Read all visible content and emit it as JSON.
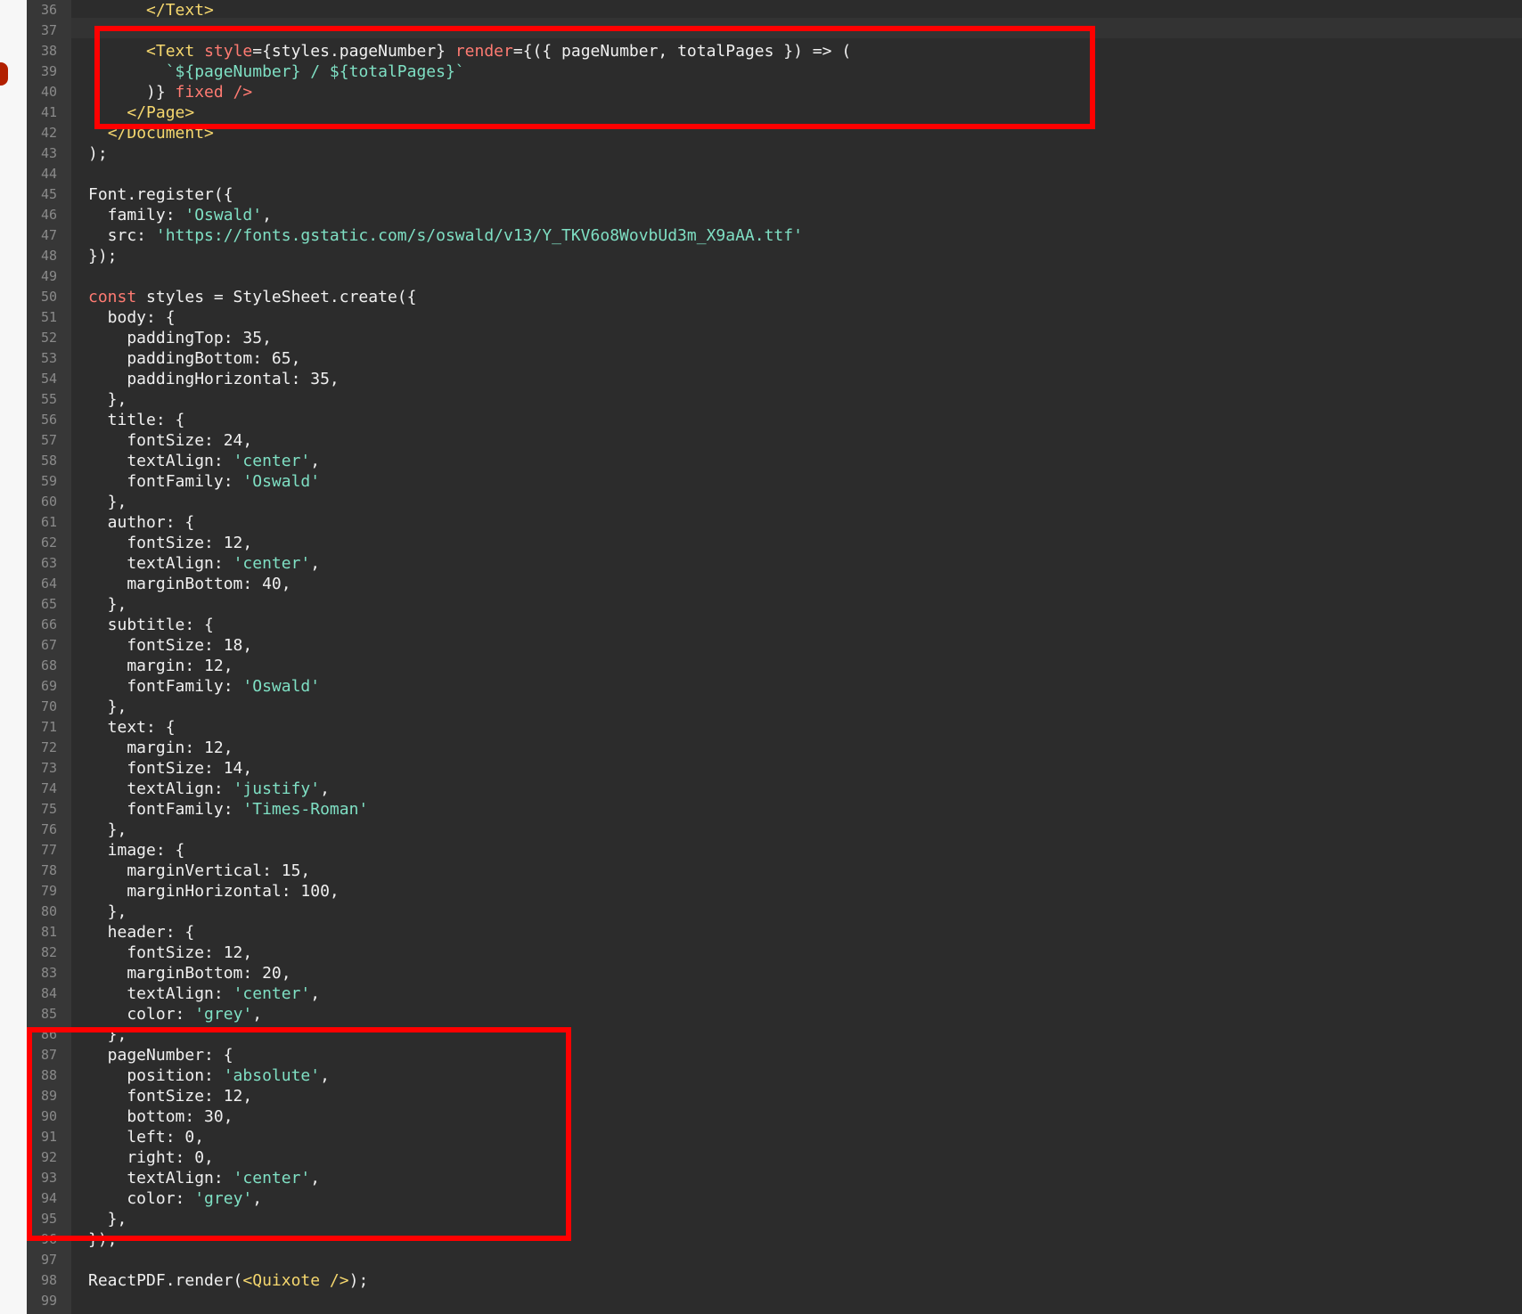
{
  "editor": {
    "highlight_color": "#ff0000",
    "first_line_number": 36,
    "lines": [
      {
        "n": "36",
        "tokens": [
          {
            "t": "      ",
            "c": "plain"
          },
          {
            "t": "</Text>",
            "c": "tag"
          }
        ]
      },
      {
        "n": "37",
        "tokens": []
      },
      {
        "n": "38",
        "tokens": [
          {
            "t": "      ",
            "c": "plain"
          },
          {
            "t": "<Text ",
            "c": "tag"
          },
          {
            "t": "style",
            "c": "attr"
          },
          {
            "t": "={styles.pageNumber} ",
            "c": "plain"
          },
          {
            "t": "render",
            "c": "attr"
          },
          {
            "t": "={({ pageNumber, totalPages }) => (",
            "c": "plain"
          }
        ]
      },
      {
        "n": "39",
        "tokens": [
          {
            "t": "        ",
            "c": "plain"
          },
          {
            "t": "`${pageNumber} / ${totalPages}`",
            "c": "str"
          }
        ]
      },
      {
        "n": "40",
        "tokens": [
          {
            "t": "      )} ",
            "c": "plain"
          },
          {
            "t": "fixed",
            "c": "attr"
          },
          {
            "t": " />",
            "c": "attr"
          }
        ]
      },
      {
        "n": "41",
        "tokens": [
          {
            "t": "    ",
            "c": "plain"
          },
          {
            "t": "</Page>",
            "c": "tag"
          }
        ]
      },
      {
        "n": "42",
        "tokens": [
          {
            "t": "  ",
            "c": "plain"
          },
          {
            "t": "</Document>",
            "c": "tag"
          }
        ]
      },
      {
        "n": "43",
        "tokens": [
          {
            "t": ");",
            "c": "plain"
          }
        ]
      },
      {
        "n": "44",
        "tokens": []
      },
      {
        "n": "45",
        "tokens": [
          {
            "t": "Font.register({",
            "c": "plain"
          }
        ]
      },
      {
        "n": "46",
        "tokens": [
          {
            "t": "  family: ",
            "c": "plain"
          },
          {
            "t": "'Oswald'",
            "c": "str"
          },
          {
            "t": ",",
            "c": "plain"
          }
        ]
      },
      {
        "n": "47",
        "tokens": [
          {
            "t": "  src: ",
            "c": "plain"
          },
          {
            "t": "'https://fonts.gstatic.com/s/oswald/v13/Y_TKV6o8WovbUd3m_X9aAA.ttf'",
            "c": "str"
          }
        ]
      },
      {
        "n": "48",
        "tokens": [
          {
            "t": "});",
            "c": "plain"
          }
        ]
      },
      {
        "n": "49",
        "tokens": []
      },
      {
        "n": "50",
        "tokens": [
          {
            "t": "const",
            "c": "kw"
          },
          {
            "t": " styles = StyleSheet.create({",
            "c": "plain"
          }
        ]
      },
      {
        "n": "51",
        "tokens": [
          {
            "t": "  body: {",
            "c": "plain"
          }
        ]
      },
      {
        "n": "52",
        "tokens": [
          {
            "t": "    paddingTop: 35,",
            "c": "plain"
          }
        ]
      },
      {
        "n": "53",
        "tokens": [
          {
            "t": "    paddingBottom: 65,",
            "c": "plain"
          }
        ]
      },
      {
        "n": "54",
        "tokens": [
          {
            "t": "    paddingHorizontal: 35,",
            "c": "plain"
          }
        ]
      },
      {
        "n": "55",
        "tokens": [
          {
            "t": "  },",
            "c": "plain"
          }
        ]
      },
      {
        "n": "56",
        "tokens": [
          {
            "t": "  title: {",
            "c": "plain"
          }
        ]
      },
      {
        "n": "57",
        "tokens": [
          {
            "t": "    fontSize: 24,",
            "c": "plain"
          }
        ]
      },
      {
        "n": "58",
        "tokens": [
          {
            "t": "    textAlign: ",
            "c": "plain"
          },
          {
            "t": "'center'",
            "c": "str"
          },
          {
            "t": ",",
            "c": "plain"
          }
        ]
      },
      {
        "n": "59",
        "tokens": [
          {
            "t": "    fontFamily: ",
            "c": "plain"
          },
          {
            "t": "'Oswald'",
            "c": "str"
          }
        ]
      },
      {
        "n": "60",
        "tokens": [
          {
            "t": "  },",
            "c": "plain"
          }
        ]
      },
      {
        "n": "61",
        "tokens": [
          {
            "t": "  author: {",
            "c": "plain"
          }
        ]
      },
      {
        "n": "62",
        "tokens": [
          {
            "t": "    fontSize: 12,",
            "c": "plain"
          }
        ]
      },
      {
        "n": "63",
        "tokens": [
          {
            "t": "    textAlign: ",
            "c": "plain"
          },
          {
            "t": "'center'",
            "c": "str"
          },
          {
            "t": ",",
            "c": "plain"
          }
        ]
      },
      {
        "n": "64",
        "tokens": [
          {
            "t": "    marginBottom: 40,",
            "c": "plain"
          }
        ]
      },
      {
        "n": "65",
        "tokens": [
          {
            "t": "  },",
            "c": "plain"
          }
        ]
      },
      {
        "n": "66",
        "tokens": [
          {
            "t": "  subtitle: {",
            "c": "plain"
          }
        ]
      },
      {
        "n": "67",
        "tokens": [
          {
            "t": "    fontSize: 18,",
            "c": "plain"
          }
        ]
      },
      {
        "n": "68",
        "tokens": [
          {
            "t": "    margin: 12,",
            "c": "plain"
          }
        ]
      },
      {
        "n": "69",
        "tokens": [
          {
            "t": "    fontFamily: ",
            "c": "plain"
          },
          {
            "t": "'Oswald'",
            "c": "str"
          }
        ]
      },
      {
        "n": "70",
        "tokens": [
          {
            "t": "  },",
            "c": "plain"
          }
        ]
      },
      {
        "n": "71",
        "tokens": [
          {
            "t": "  text: {",
            "c": "plain"
          }
        ]
      },
      {
        "n": "72",
        "tokens": [
          {
            "t": "    margin: 12,",
            "c": "plain"
          }
        ]
      },
      {
        "n": "73",
        "tokens": [
          {
            "t": "    fontSize: 14,",
            "c": "plain"
          }
        ]
      },
      {
        "n": "74",
        "tokens": [
          {
            "t": "    textAlign: ",
            "c": "plain"
          },
          {
            "t": "'justify'",
            "c": "str"
          },
          {
            "t": ",",
            "c": "plain"
          }
        ]
      },
      {
        "n": "75",
        "tokens": [
          {
            "t": "    fontFamily: ",
            "c": "plain"
          },
          {
            "t": "'Times-Roman'",
            "c": "str"
          }
        ]
      },
      {
        "n": "76",
        "tokens": [
          {
            "t": "  },",
            "c": "plain"
          }
        ]
      },
      {
        "n": "77",
        "tokens": [
          {
            "t": "  image: {",
            "c": "plain"
          }
        ]
      },
      {
        "n": "78",
        "tokens": [
          {
            "t": "    marginVertical: 15,",
            "c": "plain"
          }
        ]
      },
      {
        "n": "79",
        "tokens": [
          {
            "t": "    marginHorizontal: 100,",
            "c": "plain"
          }
        ]
      },
      {
        "n": "80",
        "tokens": [
          {
            "t": "  },",
            "c": "plain"
          }
        ]
      },
      {
        "n": "81",
        "tokens": [
          {
            "t": "  header: {",
            "c": "plain"
          }
        ]
      },
      {
        "n": "82",
        "tokens": [
          {
            "t": "    fontSize: 12,",
            "c": "plain"
          }
        ]
      },
      {
        "n": "83",
        "tokens": [
          {
            "t": "    marginBottom: 20,",
            "c": "plain"
          }
        ]
      },
      {
        "n": "84",
        "tokens": [
          {
            "t": "    textAlign: ",
            "c": "plain"
          },
          {
            "t": "'center'",
            "c": "str"
          },
          {
            "t": ",",
            "c": "plain"
          }
        ]
      },
      {
        "n": "85",
        "tokens": [
          {
            "t": "    color: ",
            "c": "plain"
          },
          {
            "t": "'grey'",
            "c": "str"
          },
          {
            "t": ",",
            "c": "plain"
          }
        ]
      },
      {
        "n": "86",
        "tokens": [
          {
            "t": "  },",
            "c": "plain"
          }
        ]
      },
      {
        "n": "87",
        "tokens": [
          {
            "t": "  pageNumber: {",
            "c": "plain"
          }
        ]
      },
      {
        "n": "88",
        "tokens": [
          {
            "t": "    position: ",
            "c": "plain"
          },
          {
            "t": "'absolute'",
            "c": "str"
          },
          {
            "t": ",",
            "c": "plain"
          }
        ]
      },
      {
        "n": "89",
        "tokens": [
          {
            "t": "    fontSize: 12,",
            "c": "plain"
          }
        ]
      },
      {
        "n": "90",
        "tokens": [
          {
            "t": "    bottom: 30,",
            "c": "plain"
          }
        ]
      },
      {
        "n": "91",
        "tokens": [
          {
            "t": "    left: 0,",
            "c": "plain"
          }
        ]
      },
      {
        "n": "92",
        "tokens": [
          {
            "t": "    right: 0,",
            "c": "plain"
          }
        ]
      },
      {
        "n": "93",
        "tokens": [
          {
            "t": "    textAlign: ",
            "c": "plain"
          },
          {
            "t": "'center'",
            "c": "str"
          },
          {
            "t": ",",
            "c": "plain"
          }
        ]
      },
      {
        "n": "94",
        "tokens": [
          {
            "t": "    color: ",
            "c": "plain"
          },
          {
            "t": "'grey'",
            "c": "str"
          },
          {
            "t": ",",
            "c": "plain"
          }
        ]
      },
      {
        "n": "95",
        "tokens": [
          {
            "t": "  },",
            "c": "plain"
          }
        ]
      },
      {
        "n": "96",
        "tokens": [
          {
            "t": "});",
            "c": "plain"
          }
        ]
      },
      {
        "n": "97",
        "tokens": []
      },
      {
        "n": "98",
        "tokens": [
          {
            "t": "ReactPDF.render(",
            "c": "plain"
          },
          {
            "t": "<Quixote />",
            "c": "tag"
          },
          {
            "t": ");",
            "c": "plain"
          }
        ]
      },
      {
        "n": "99",
        "tokens": []
      }
    ]
  }
}
